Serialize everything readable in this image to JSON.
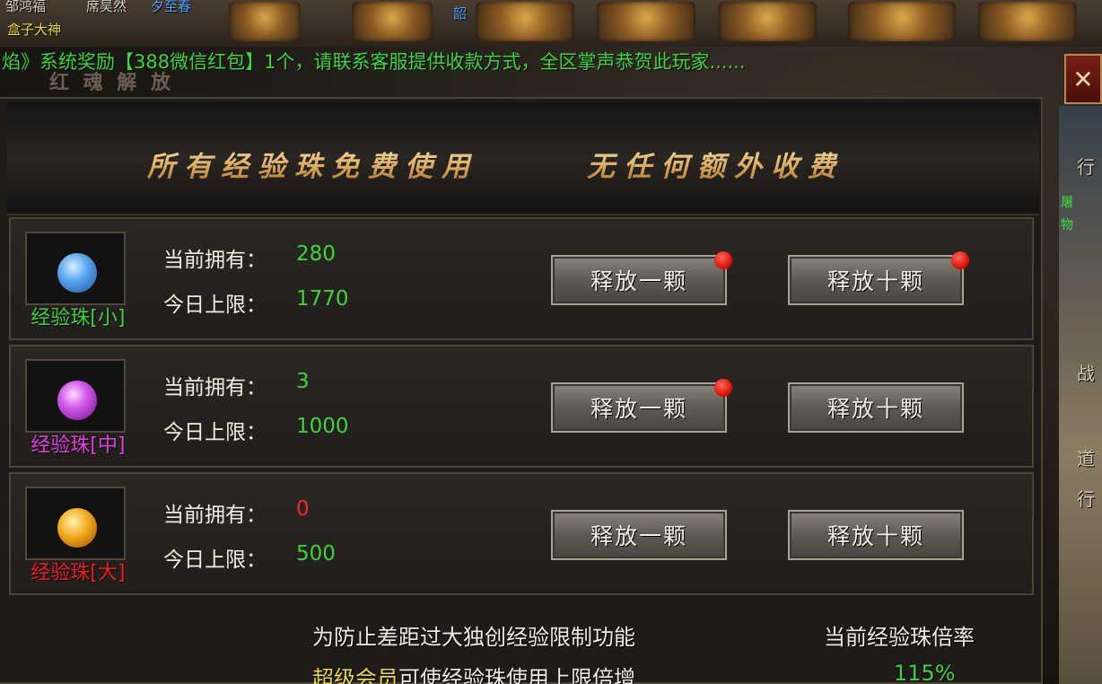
{
  "top_bar": {
    "names": [
      "邹鸿福",
      "席昊然",
      "夕至春",
      "盒子大神",
      "韶"
    ]
  },
  "broadcast": "焰》系统奖励【388微信红包】1个，请联系客服提供收款方式，全区掌声恭贺此玩家......",
  "panel_ghost_title": "红 魂 解 放",
  "close_label": "✕",
  "banner": {
    "left": "所有经验珠免费使用",
    "right": "无任何额外收费"
  },
  "side": {
    "chars": [
      "行",
      "战",
      "道",
      "行"
    ],
    "green": [
      "屠",
      "物"
    ]
  },
  "stats_labels": {
    "owned": "当前拥有：",
    "limit": "今日上限："
  },
  "rows": [
    {
      "name": "经验珠[小]",
      "name_color": "#3ed23e",
      "orb_color": "blue",
      "owned": "280",
      "owned_color": "#3ed23e",
      "limit": "1770",
      "btn1": "释放一颗",
      "btn2": "释放十颗",
      "dot1": true,
      "dot2": true
    },
    {
      "name": "经验珠[中]",
      "name_color": "#e040e0",
      "orb_color": "purple",
      "owned": "3",
      "owned_color": "#3ed23e",
      "limit": "1000",
      "btn1": "释放一颗",
      "btn2": "释放十颗",
      "dot1": true,
      "dot2": false
    },
    {
      "name": "经验珠[大]",
      "name_color": "#f02020",
      "orb_color": "gold",
      "owned": "0",
      "owned_color": "#f02a2a",
      "limit": "500",
      "btn1": "释放一颗",
      "btn2": "释放十颗",
      "dot1": false,
      "dot2": false
    }
  ],
  "footer": {
    "line1": "为防止差距过大独创经验限制功能",
    "vip": "超级会员",
    "line2_rest": "可使经验珠使用上限倍增",
    "rate_label": "当前经验珠倍率",
    "rate_value": "115%"
  },
  "colors": {
    "green": "#3ed23e",
    "gold_text": "#e8d84a",
    "red": "#f02020"
  }
}
